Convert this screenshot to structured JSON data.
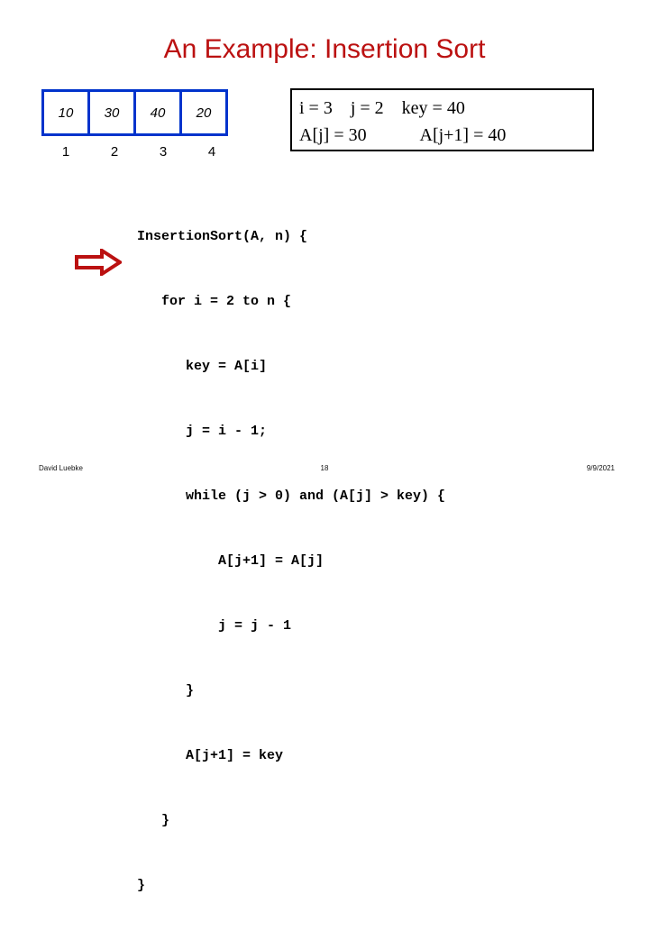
{
  "slide": {
    "title": "An Example: Insertion Sort"
  },
  "array": {
    "values": [
      "10",
      "30",
      "40",
      "20"
    ],
    "indices": [
      "1",
      "2",
      "3",
      "4"
    ],
    "border_color": "#0033cc"
  },
  "annotation": {
    "line1": "i = 3    j = 2    key = 40",
    "line2": "A[j] = 30            A[j+1] = 40",
    "border_color": "#000000"
  },
  "pointer": {
    "icon": "right-arrow-icon",
    "color": "#bb1111"
  },
  "code": {
    "lines": [
      "InsertionSort(A, n) {",
      "   for i = 2 to n {",
      "      key = A[i]",
      "      j = i - 1;",
      "      while (j > 0) and (A[j] > key) {",
      "          A[j+1] = A[j]",
      "          j = j - 1",
      "      }",
      "      A[j+1] = key",
      "   }",
      "}"
    ]
  },
  "footer": {
    "author": "David Luebke",
    "page_number": "18",
    "date": "9/9/2021"
  },
  "colors": {
    "title": "#bb1111",
    "array_border": "#0033cc",
    "arrow": "#bb1111",
    "text": "#000000"
  }
}
